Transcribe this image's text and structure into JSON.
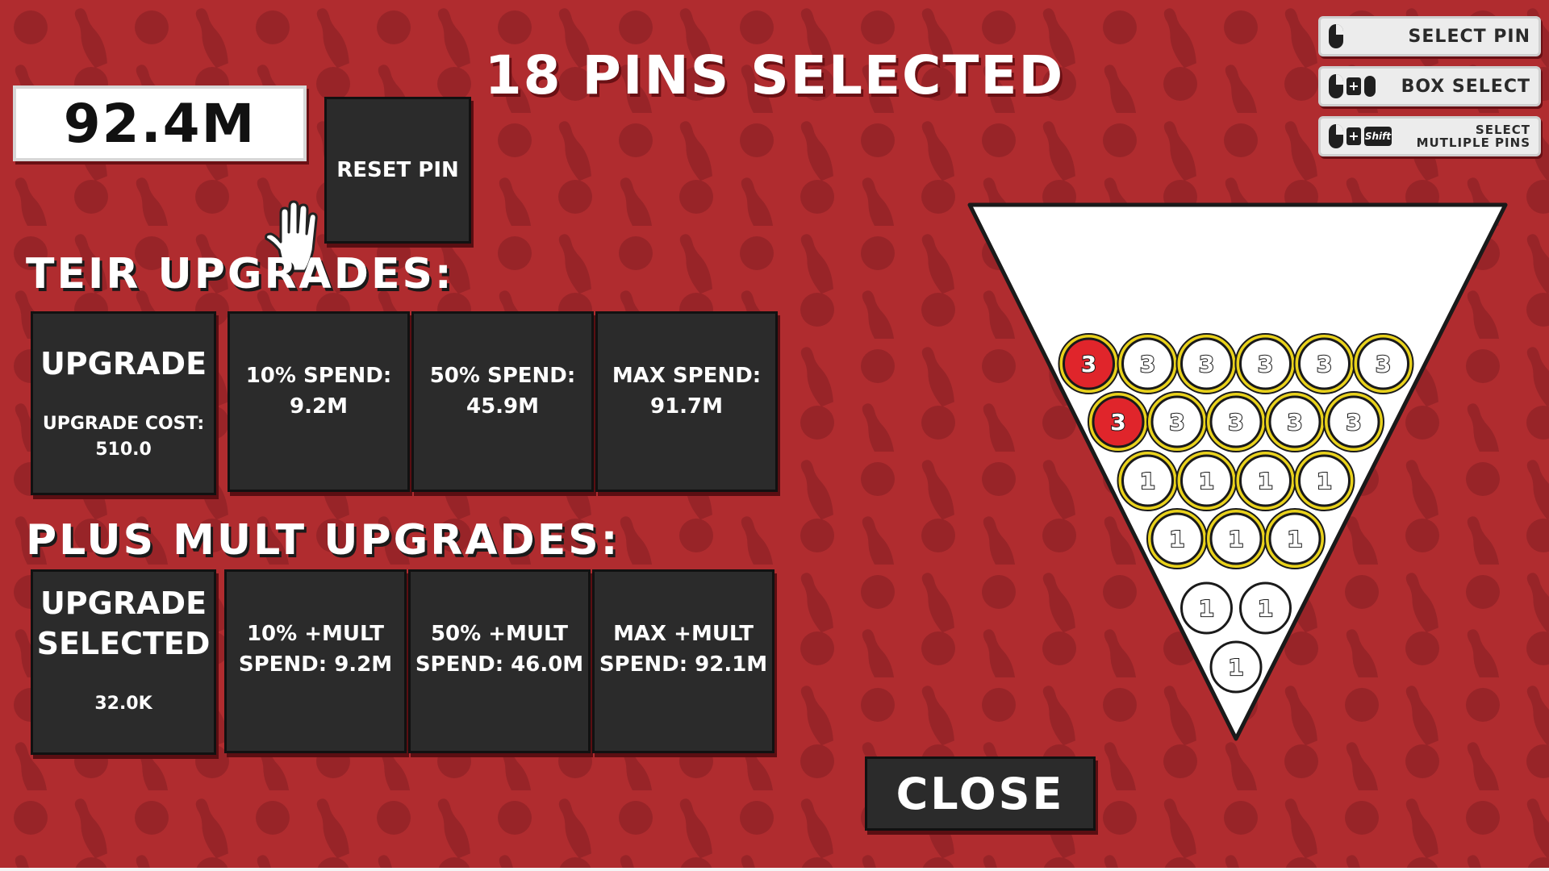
{
  "title": "18 PINS SELECTED",
  "money": "92.4M",
  "reset_pin": "RESET PIN",
  "tier_heading": "TEIR UPGRADES:",
  "tier_upgrade": {
    "title": "UPGRADE",
    "cost_label": "UPGRADE COST:",
    "cost_value": "510.0"
  },
  "tier_spend": [
    {
      "line1": "10% SPEND:",
      "line2": "9.2M"
    },
    {
      "line1": "50% SPEND:",
      "line2": "45.9M"
    },
    {
      "line1": "MAX SPEND:",
      "line2": "91.7M"
    }
  ],
  "mult_heading": "PLUS MULT UPGRADES:",
  "mult_upgrade": {
    "line1": "UPGRADE",
    "line2": "SELECTED",
    "cost": "32.0K"
  },
  "mult_spend": [
    {
      "line1": "10% +MULT",
      "line2": "SPEND: 9.2M"
    },
    {
      "line1": "50% +MULT",
      "line2": "SPEND: 46.0M"
    },
    {
      "line1": "MAX +MULT",
      "line2": "SPEND: 92.1M"
    }
  ],
  "close": "CLOSE",
  "controls": {
    "select_pin": "SELECT PIN",
    "box_select": "BOX SELECT",
    "multiple_line1": "SELECT",
    "multiple_line2": "MUTLIPLE PINS",
    "shift_key": "Shift",
    "plus": "+"
  },
  "pins": {
    "rows": [
      [
        {
          "label": "3",
          "selected": true,
          "red": true
        },
        {
          "label": "3",
          "selected": true,
          "red": false
        },
        {
          "label": "3",
          "selected": true,
          "red": false
        },
        {
          "label": "3",
          "selected": true,
          "red": false
        },
        {
          "label": "3",
          "selected": true,
          "red": false
        },
        {
          "label": "3",
          "selected": true,
          "red": false
        }
      ],
      [
        {
          "label": "3",
          "selected": true,
          "red": true
        },
        {
          "label": "3",
          "selected": true,
          "red": false
        },
        {
          "label": "3",
          "selected": true,
          "red": false
        },
        {
          "label": "3",
          "selected": true,
          "red": false
        },
        {
          "label": "3",
          "selected": true,
          "red": false
        }
      ],
      [
        {
          "label": "1",
          "selected": true,
          "red": false
        },
        {
          "label": "1",
          "selected": true,
          "red": false
        },
        {
          "label": "1",
          "selected": true,
          "red": false
        },
        {
          "label": "1",
          "selected": true,
          "red": false
        }
      ],
      [
        {
          "label": "1",
          "selected": true,
          "red": false
        },
        {
          "label": "1",
          "selected": true,
          "red": false
        },
        {
          "label": "1",
          "selected": true,
          "red": false
        }
      ],
      [
        {
          "label": "1",
          "selected": false,
          "red": false
        },
        {
          "label": "1",
          "selected": false,
          "red": false
        }
      ],
      [
        {
          "label": "1",
          "selected": false,
          "red": false
        }
      ]
    ]
  },
  "colors": {
    "background": "#b02c2f",
    "button": "#2b2b2b",
    "pin_select_ring": "#e9d21c",
    "red_pin": "#e0252b"
  }
}
